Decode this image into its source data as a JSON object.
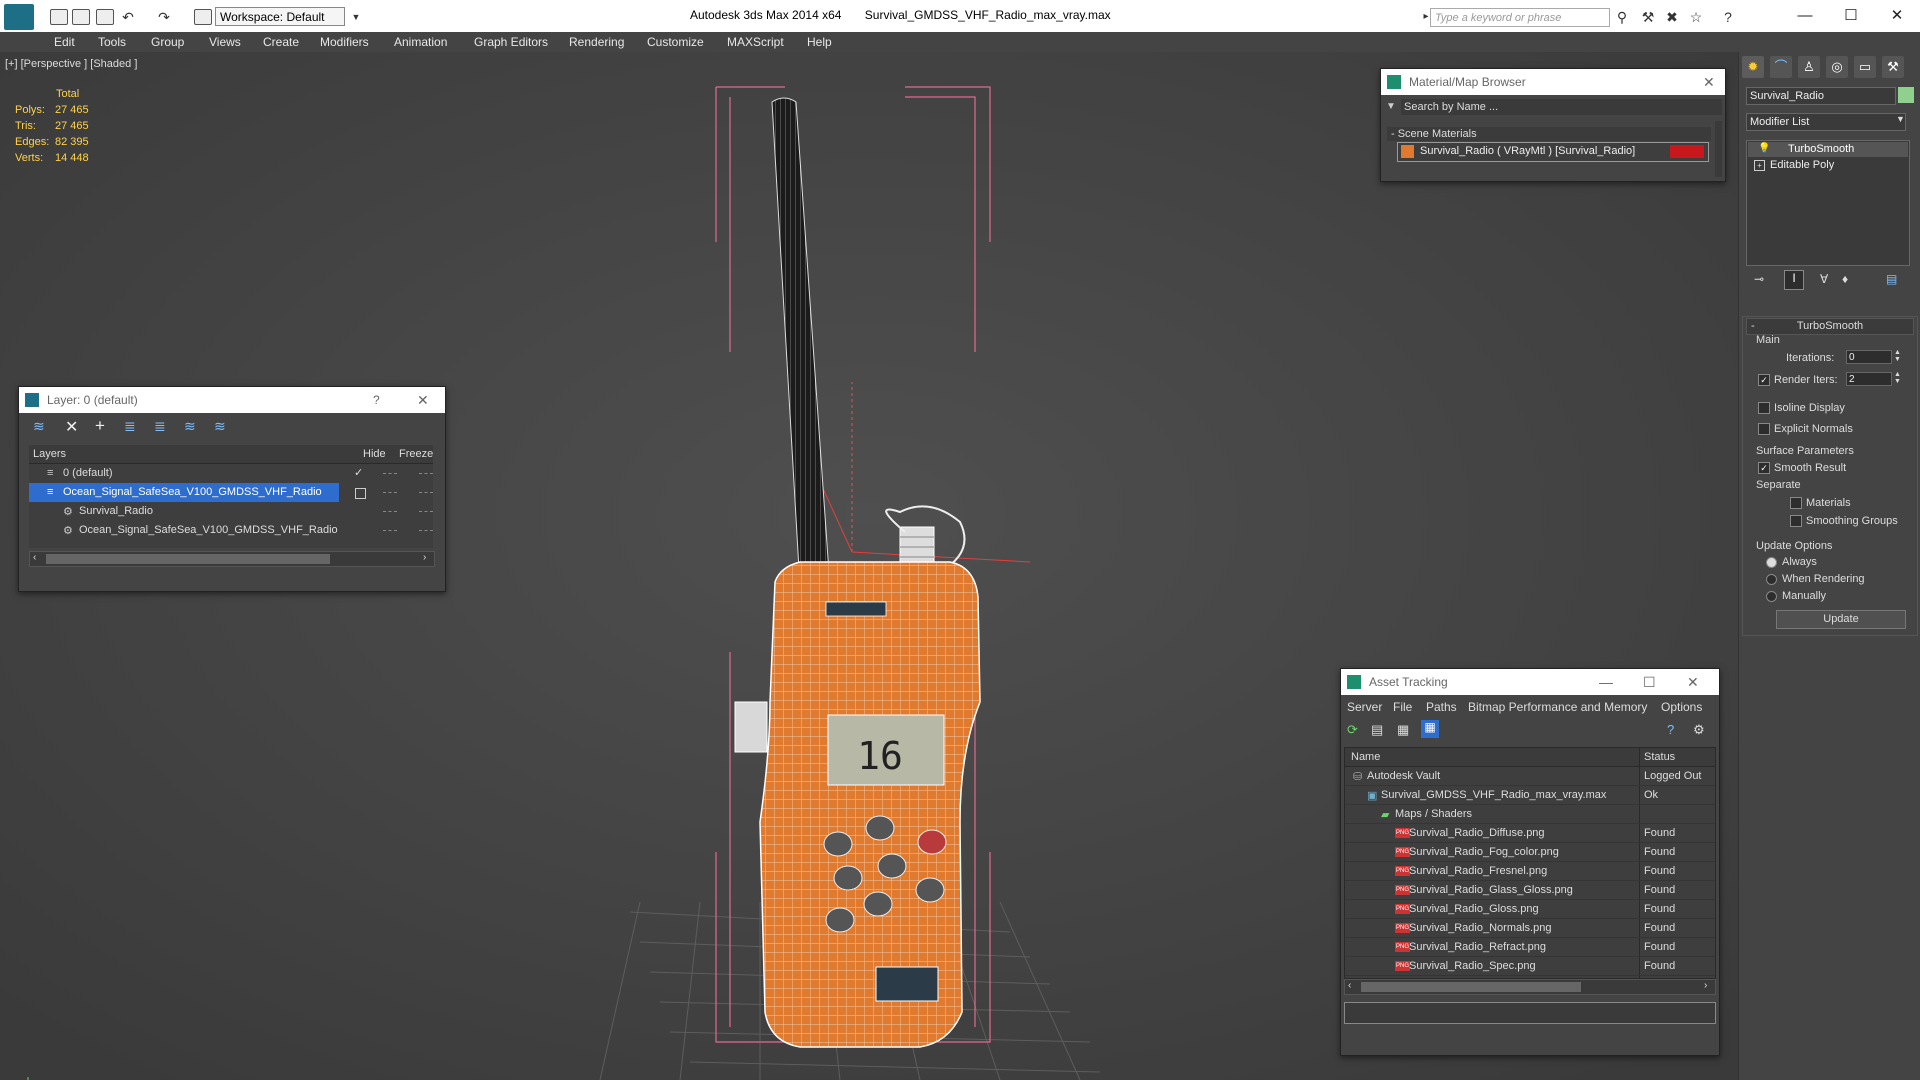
{
  "titlebar": {
    "workspace": "Workspace: Default",
    "app_title": "Autodesk 3ds Max  2014 x64",
    "file_title": "Survival_GMDSS_VHF_Radio_max_vray.max",
    "search_placeholder": "Type a keyword or phrase"
  },
  "menu": [
    "Edit",
    "Tools",
    "Group",
    "Views",
    "Create",
    "Modifiers",
    "Animation",
    "Graph Editors",
    "Rendering",
    "Customize",
    "MAXScript",
    "Help"
  ],
  "viewport": {
    "label": "[+] [Perspective ] [Shaded ]",
    "stats": {
      "header": "Total",
      "polys_label": "Polys:",
      "polys": "27 465",
      "tris_label": "Tris:",
      "tris": "27 465",
      "edges_label": "Edges:",
      "edges": "82 395",
      "verts_label": "Verts:",
      "verts": "14 448"
    },
    "display_digits": "16"
  },
  "layer_window": {
    "title": "Layer: 0 (default)",
    "help": "?",
    "col_layers": "Layers",
    "col_hide": "Hide",
    "col_freeze": "Freeze",
    "rows": [
      {
        "label": "0 (default)"
      },
      {
        "label": "Ocean_Signal_SafeSea_V100_GMDSS_VHF_Radio"
      },
      {
        "label": "Survival_Radio"
      },
      {
        "label": "Ocean_Signal_SafeSea_V100_GMDSS_VHF_Radio"
      }
    ]
  },
  "material_browser": {
    "title": "Material/Map Browser",
    "search": "Search by Name ...",
    "section": "- Scene Materials",
    "material": "Survival_Radio  ( VRayMtl ) [Survival_Radio]"
  },
  "command_panel": {
    "object_name": "Survival_Radio",
    "modifier_list": "Modifier List",
    "stack": [
      "TurboSmooth",
      "Editable Poly"
    ],
    "rollout_title": "TurboSmooth",
    "main_label": "Main",
    "iterations_label": "Iterations:",
    "iterations_value": "0",
    "render_iters_label": "Render Iters:",
    "render_iters_value": "2",
    "isoline": "Isoline Display",
    "explicit_normals": "Explicit Normals",
    "surface_params": "Surface Parameters",
    "smooth_result": "Smooth Result",
    "separate": "Separate",
    "materials": "Materials",
    "smoothing_groups": "Smoothing Groups",
    "update_options": "Update Options",
    "always": "Always",
    "when_rendering": "When Rendering",
    "manually": "Manually",
    "update_button": "Update",
    "object_color": "#8fd08f"
  },
  "asset_tracking": {
    "title": "Asset Tracking",
    "menu": [
      "Server",
      "File",
      "Paths",
      "Bitmap Performance and Memory",
      "Options"
    ],
    "col_name": "Name",
    "col_status": "Status",
    "rows": [
      {
        "name": "Autodesk Vault",
        "status": "Logged Out"
      },
      {
        "name": "Survival_GMDSS_VHF_Radio_max_vray.max",
        "status": "Ok"
      },
      {
        "name": "Maps / Shaders",
        "status": ""
      },
      {
        "name": "Survival_Radio_Diffuse.png",
        "status": "Found"
      },
      {
        "name": "Survival_Radio_Fog_color.png",
        "status": "Found"
      },
      {
        "name": "Survival_Radio_Fresnel.png",
        "status": "Found"
      },
      {
        "name": "Survival_Radio_Glass_Gloss.png",
        "status": "Found"
      },
      {
        "name": "Survival_Radio_Gloss.png",
        "status": "Found"
      },
      {
        "name": "Survival_Radio_Normals.png",
        "status": "Found"
      },
      {
        "name": "Survival_Radio_Refract.png",
        "status": "Found"
      },
      {
        "name": "Survival_Radio_Spec.png",
        "status": "Found"
      }
    ]
  },
  "colors": {
    "radio_body": "#e07a2e",
    "selection": "#2e6ccd",
    "material_swatch": "#c8181e"
  }
}
